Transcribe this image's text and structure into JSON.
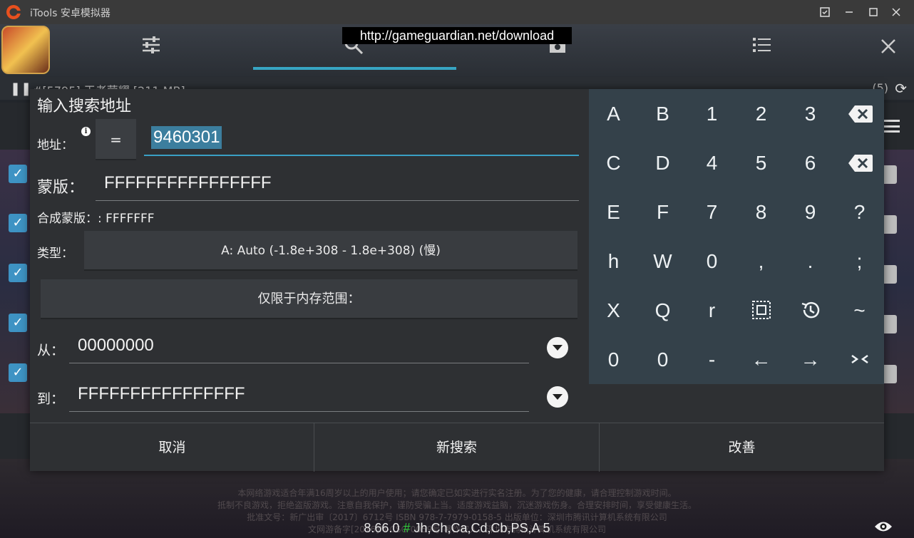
{
  "window": {
    "title": "iTools 安卓模拟器"
  },
  "overlay": {
    "url": "http://gameguardian.net/download"
  },
  "background": {
    "process": "#[5795] 王者荣耀 [211 MB]",
    "count": "(5)"
  },
  "dialog": {
    "title": "输入搜索地址",
    "address_label": "地址：",
    "operator": "=",
    "address_value": "9460301",
    "mask_label": "蒙版：",
    "mask_value": "FFFFFFFFFFFFFFFF",
    "combined_mask": "合成蒙版：: FFFFFFF",
    "type_label": "类型：",
    "type_value": "A: Auto (-1.8e+308 - 1.8e+308) (慢)",
    "memory_range": "仅限于内存范围：",
    "from_label": "从：",
    "from_value": "00000000",
    "to_label": "到：",
    "to_value": "FFFFFFFFFFFFFFFF",
    "buttons": {
      "cancel": "取消",
      "new_search": "新搜索",
      "refine": "改善"
    }
  },
  "keypad": {
    "rows": [
      [
        "A",
        "B",
        "1",
        "2",
        "3",
        "backspace-icon"
      ],
      [
        "C",
        "D",
        "4",
        "5",
        "6",
        "clear-icon"
      ],
      [
        "E",
        "F",
        "7",
        "8",
        "9",
        "?"
      ],
      [
        "h",
        "W",
        "0",
        ",",
        ".",
        ";"
      ],
      [
        "X",
        "Q",
        "r",
        "select-all-icon",
        "history-icon",
        "~"
      ],
      [
        "0",
        "0",
        "-",
        "←",
        "→",
        "collapse-icon"
      ]
    ]
  },
  "footer": {
    "version": "8.66.0",
    "hash_sign": "#",
    "flags": "Jh,Ch,Ca,Cd,Cb,PS,A",
    "flags_count": "5",
    "notice_line1": "本网络游戏适合年满16周岁以上的用户使用；请您确定已如实进行实名注册。为了您的健康，请合理控制游戏时间。",
    "notice_line2": "抵制不良游戏，拒绝盗版游戏。注意自我保护，谨防受骗上当。适度游戏益脑，沉迷游戏伤身。合理安排时间，享受健康生活。",
    "notice_line3": "批准文号：新广出审〔2017〕6712号 ISBN 978-7-7979-0158-5 出版单位：深圳市腾讯计算机系统有限公司",
    "notice_line4": "文网游备字[2016]M-CSG 0059号 著作权人：深圳市腾讯计算机系统有限公司"
  },
  "colors": {
    "accent": "#37a5c3",
    "keypad_bg": "#34414a",
    "dialog_bg": "#2e3033",
    "hash_green": "#2fcc39"
  }
}
